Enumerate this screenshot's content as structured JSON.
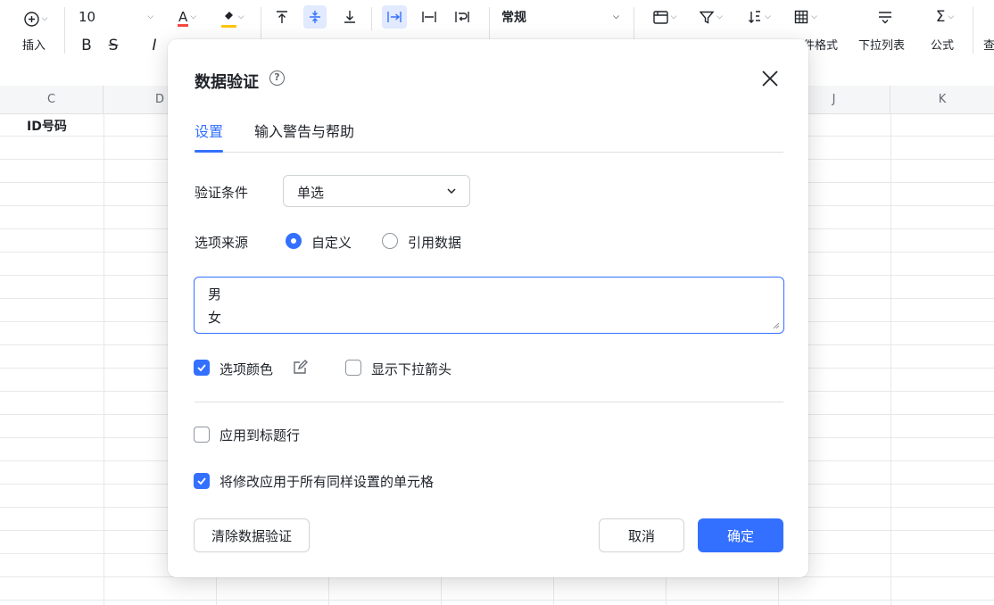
{
  "toolbar": {
    "insert_label": "插入",
    "font_size": "10",
    "bold": "B",
    "strike": "S",
    "italic": "I",
    "font_color_glyph": "A",
    "number_format": "常规",
    "cell_format_label": "件格式",
    "dropdown_list_label": "下拉列表",
    "formula_label": "公式",
    "more_label": "查",
    "accent_color": "#3370ff"
  },
  "sheet": {
    "columns": [
      "C",
      "D",
      "J",
      "K"
    ],
    "cell_c1": "ID号码"
  },
  "dialog": {
    "title": "数据验证",
    "tabs": [
      {
        "label": "设置"
      },
      {
        "label": "输入警告与帮助"
      }
    ],
    "condition_label": "验证条件",
    "condition_value": "单选",
    "source_label": "选项来源",
    "source_options": [
      {
        "label": "自定义",
        "selected": true
      },
      {
        "label": "引用数据",
        "selected": false
      }
    ],
    "options_lines": [
      "男",
      "女"
    ],
    "option_color_label": "选项颜色",
    "option_color_checked": true,
    "show_arrow_label": "显示下拉箭头",
    "show_arrow_checked": false,
    "apply_header_label": "应用到标题行",
    "apply_header_checked": false,
    "apply_all_label": "将修改应用于所有同样设置的单元格",
    "apply_all_checked": true,
    "clear_button": "清除数据验证",
    "cancel_button": "取消",
    "ok_button": "确定"
  }
}
